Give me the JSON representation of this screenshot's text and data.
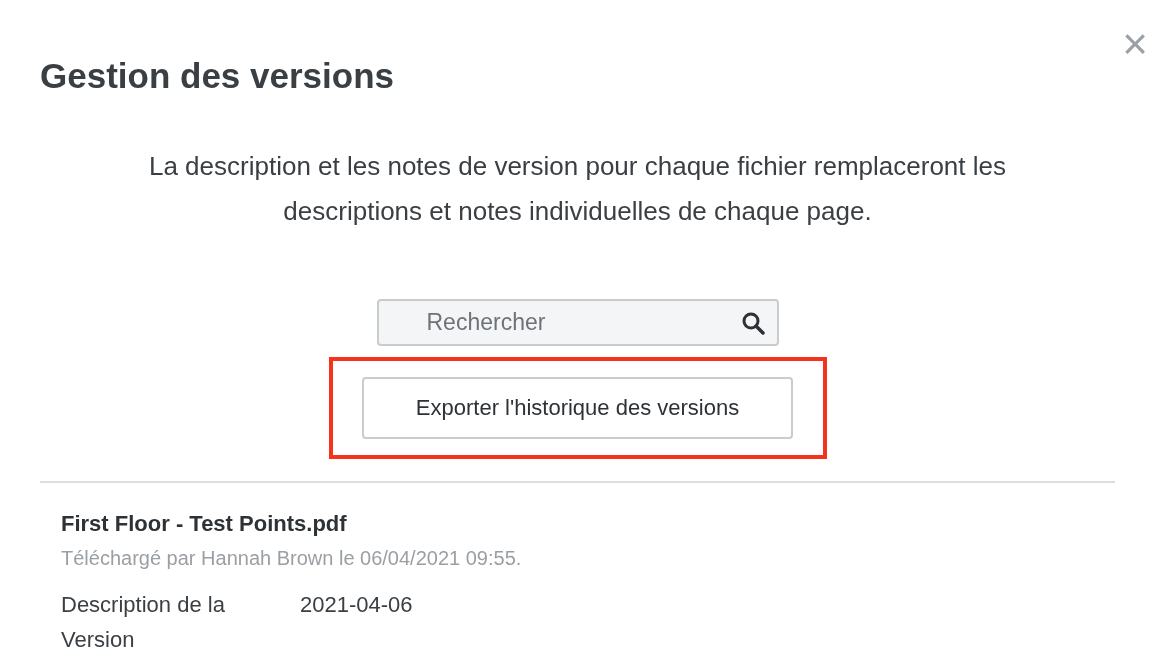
{
  "dialog": {
    "title": "Gestion des versions",
    "close": "×",
    "description": "La description et les notes de version pour chaque fichier remplaceront les descriptions et notes individuelles de chaque page."
  },
  "search": {
    "placeholder": "Rechercher"
  },
  "export_button": {
    "label": "Exporter l'historique des versions",
    "highlighted": true
  },
  "files": [
    {
      "name": "First Floor - Test Points.pdf",
      "uploaded": "Téléchargé par Hannah Brown le 06/04/2021 09:55.",
      "fields": [
        {
          "label": "Description de la Version",
          "value": "2021-04-06"
        }
      ]
    }
  ]
}
